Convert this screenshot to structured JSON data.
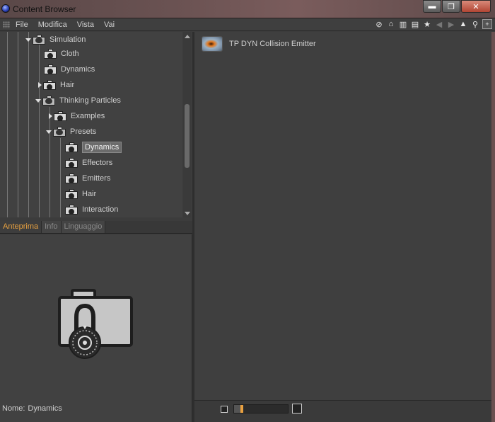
{
  "window": {
    "title": "Content Browser",
    "controls": [
      "▬",
      "❐",
      "✕"
    ]
  },
  "menu": {
    "items": [
      "File",
      "Modifica",
      "Vista",
      "Vai"
    ]
  },
  "toolbar": {
    "icons": [
      "link-icon",
      "home-icon",
      "bucket-icon",
      "book-icon",
      "star-icon",
      "back-icon",
      "forward-icon",
      "up-icon",
      "search-icon",
      "add-icon"
    ]
  },
  "tree": {
    "items": [
      {
        "label": "Simulation",
        "state": "open",
        "selected": false
      },
      {
        "label": "Cloth",
        "state": "none",
        "selected": false
      },
      {
        "label": "Dynamics",
        "state": "none",
        "selected": false
      },
      {
        "label": "Hair",
        "state": "closed",
        "selected": false
      },
      {
        "label": "Thinking Particles",
        "state": "open",
        "selected": false
      },
      {
        "label": "Examples",
        "state": "closed",
        "selected": false
      },
      {
        "label": "Presets",
        "state": "open",
        "selected": false
      },
      {
        "label": "Dynamics",
        "state": "none",
        "selected": true
      },
      {
        "label": "Effectors",
        "state": "none",
        "selected": false
      },
      {
        "label": "Emitters",
        "state": "none",
        "selected": false
      },
      {
        "label": "Hair",
        "state": "none",
        "selected": false
      },
      {
        "label": "Interaction",
        "state": "none",
        "selected": false
      }
    ]
  },
  "preview": {
    "tabs": [
      "Anteprima",
      "Info",
      "Linguaggio"
    ],
    "active_tab": "Anteprima",
    "name_label": "Nome:",
    "name_value": "Dynamics"
  },
  "content": {
    "items": [
      {
        "label": "TP DYN Collision Emitter"
      }
    ]
  },
  "zoom": {
    "level": 0.12
  },
  "colors": {
    "accent": "#e8a040",
    "background": "#3f3f3f"
  }
}
